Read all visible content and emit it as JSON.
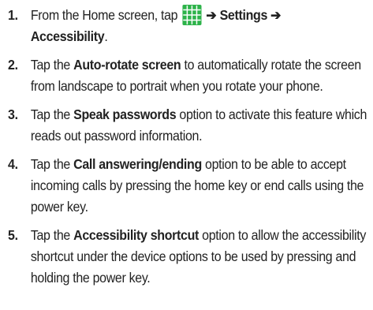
{
  "steps": [
    {
      "num": "1.",
      "parts": {
        "a": "From the Home screen, tap ",
        "arrow1": "➔",
        "b1": "Settings",
        "arrow2": "➔",
        "b2": "Accessibility",
        "c": "."
      },
      "icon": "apps-grid-icon",
      "icon_color": "#2db34a"
    },
    {
      "num": "2.",
      "parts": {
        "a": "Tap the ",
        "b": "Auto-rotate screen",
        "c": " to automatically rotate the screen from landscape to portrait when you rotate your phone."
      }
    },
    {
      "num": "3.",
      "parts": {
        "a": "Tap the ",
        "b": "Speak passwords",
        "c": " option to activate this feature which reads out password information."
      }
    },
    {
      "num": "4.",
      "parts": {
        "a": "Tap the ",
        "b": "Call answering/ending",
        "c": " option to be able to accept incoming calls by pressing the home key or end calls using the power key."
      }
    },
    {
      "num": "5.",
      "parts": {
        "a": "Tap the ",
        "b": "Accessibility shortcut",
        "c": " option to allow the accessibility shortcut under the device options to be used by pressing and holding the power key."
      }
    }
  ]
}
